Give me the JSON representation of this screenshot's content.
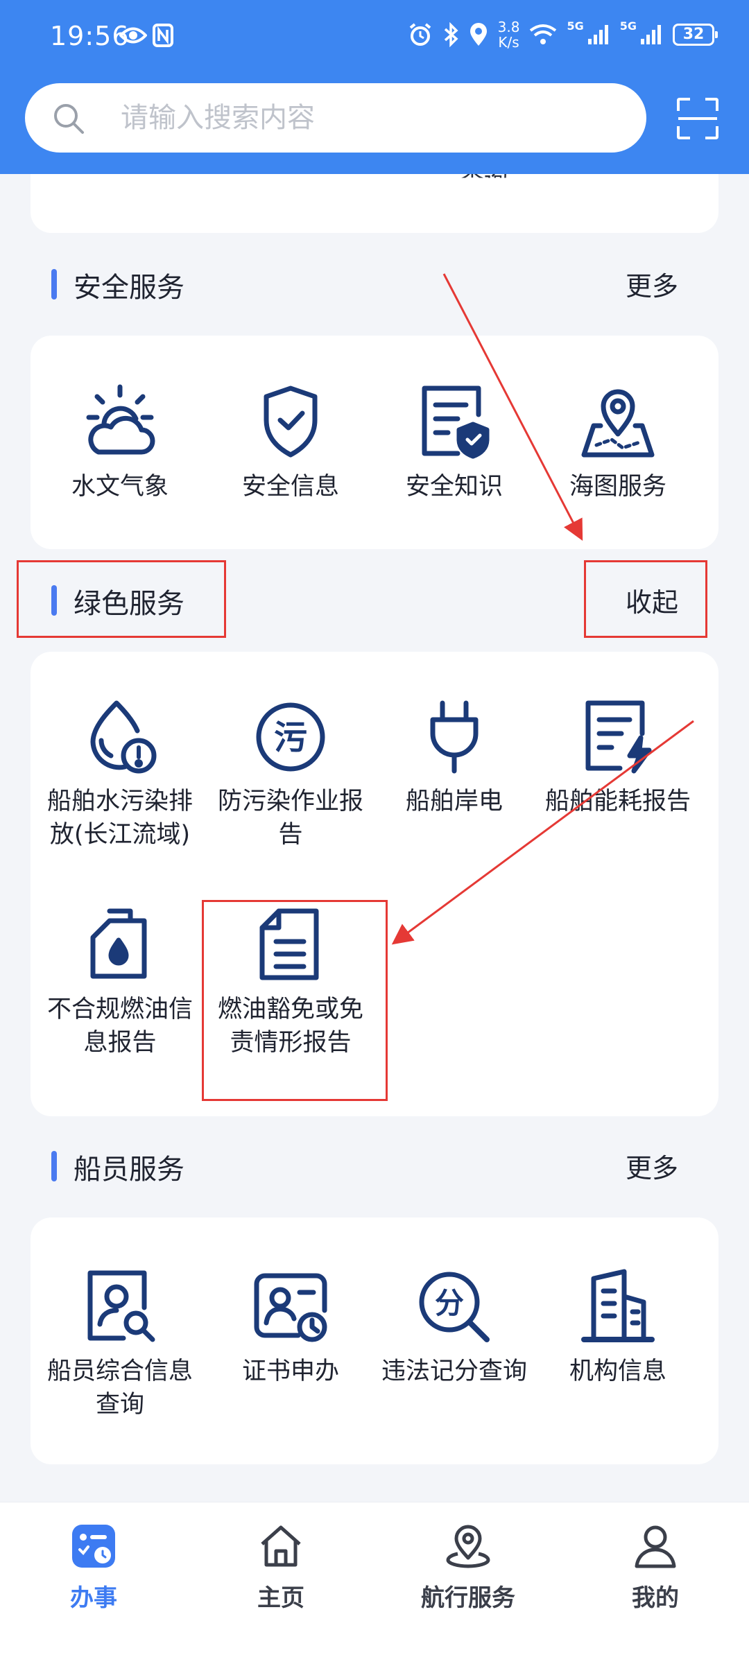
{
  "status_bar": {
    "time": "19:56",
    "net_speed_value": "3.8",
    "net_speed_unit": "K/s",
    "net1": "5G",
    "net2": "5G",
    "battery": "32"
  },
  "search": {
    "placeholder": "请输入搜索内容"
  },
  "top_card": {
    "peek_text": "查询"
  },
  "sections": {
    "safety": {
      "title": "安全服务",
      "more": "更多",
      "items": [
        {
          "label": "水文气象",
          "icon": "weather-icon"
        },
        {
          "label": "安全信息",
          "icon": "shield-check-icon"
        },
        {
          "label": "安全知识",
          "icon": "document-shield-icon"
        },
        {
          "label": "海图服务",
          "icon": "map-pin-icon"
        }
      ]
    },
    "green": {
      "title": "绿色服务",
      "collapse": "收起",
      "items": [
        {
          "label": "船舶水污染排放(长江流域)",
          "icon": "water-drop-alert-icon"
        },
        {
          "label": "防污染作业报告",
          "icon": "pollution-icon"
        },
        {
          "label": "船舶岸电",
          "icon": "power-plug-icon"
        },
        {
          "label": "船舶能耗报告",
          "icon": "energy-report-icon"
        },
        {
          "label": "不合规燃油信息报告",
          "icon": "fuel-can-icon"
        },
        {
          "label": "燃油豁免或免责情形报告",
          "icon": "document-icon"
        }
      ]
    },
    "crew": {
      "title": "船员服务",
      "more": "更多",
      "items": [
        {
          "label": "船员综合信息查询",
          "icon": "person-search-icon"
        },
        {
          "label": "证书申办",
          "icon": "certificate-icon"
        },
        {
          "label": "违法记分查询",
          "icon": "score-search-icon"
        },
        {
          "label": "机构信息",
          "icon": "building-icon"
        }
      ]
    }
  },
  "bottom_nav": [
    {
      "label": "办事",
      "active": true
    },
    {
      "label": "主页",
      "active": false
    },
    {
      "label": "航行服务",
      "active": false
    },
    {
      "label": "我的",
      "active": false
    }
  ],
  "colors": {
    "primary": "#3D86F1",
    "icon_navy": "#1B3A78",
    "annotation": "#E53935",
    "active_tab": "#3D7BF2"
  }
}
